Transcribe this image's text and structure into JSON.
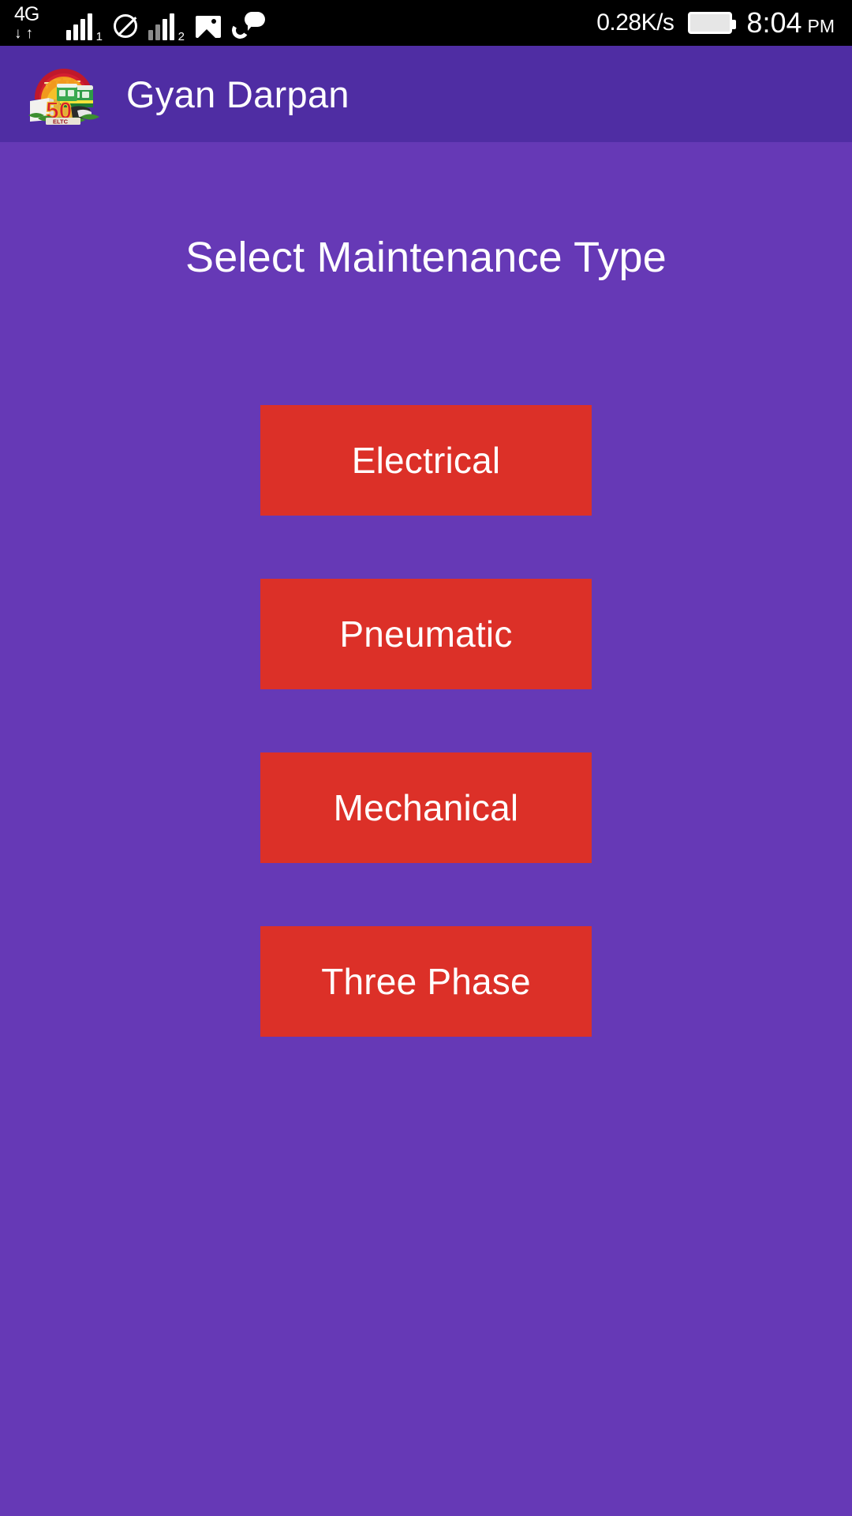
{
  "status_bar": {
    "network_type": "4G",
    "sim1_label": "1",
    "sim2_label": "2",
    "network_speed": "0.28K/s",
    "time": "8:04",
    "time_period": "PM",
    "icons": {
      "data_arrows": "↓↑",
      "signal_sim1": "signal-bars-icon",
      "blocked": "no-service-icon",
      "picture": "image-icon",
      "call_bubble": "missed-call-icon",
      "battery": "battery-icon"
    }
  },
  "app_bar": {
    "title": "Gyan Darpan",
    "logo_name": "eltc-golden-jubilee-logo",
    "logo_text_number": "50",
    "logo_text_ribbon": "ELTC",
    "background_color": "#4F2DA3"
  },
  "main": {
    "heading": "Select Maintenance Type",
    "background_color": "#6639B6",
    "button_color": "#DC3028",
    "button_text_color": "#FFFFFF",
    "buttons": [
      {
        "label": "Electrical"
      },
      {
        "label": "Pneumatic"
      },
      {
        "label": "Mechanical"
      },
      {
        "label": "Three Phase"
      }
    ]
  }
}
